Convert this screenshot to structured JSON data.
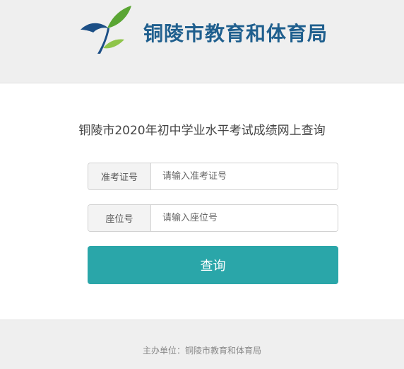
{
  "header": {
    "logo_icon": "leaf-bird-logo-icon",
    "org_name": "铜陵市教育和体育局",
    "brand_color": "#1f5f8e"
  },
  "main": {
    "title": "铜陵市2020年初中学业水平考试成绩网上查询",
    "admission_field": {
      "label": "准考证号",
      "placeholder": "请输入准考证号",
      "value": ""
    },
    "seat_field": {
      "label": "座位号",
      "placeholder": "请输入座位号",
      "value": ""
    },
    "query_button": {
      "label": "查询",
      "color": "#2aa6a9"
    }
  },
  "footer": {
    "text": "主办单位：铜陵市教育和体育局"
  }
}
